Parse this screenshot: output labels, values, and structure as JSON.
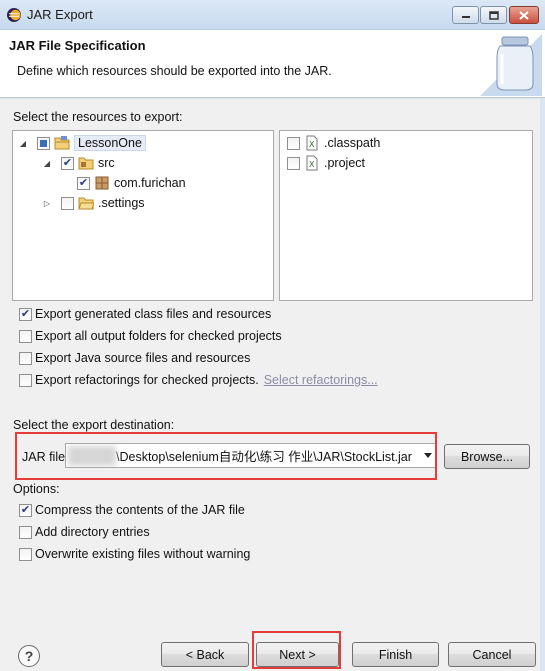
{
  "window": {
    "title": "JAR Export"
  },
  "header": {
    "title": "JAR File Specification",
    "description": "Define which resources should be exported into the JAR."
  },
  "resources": {
    "label": "Select the resources to export:",
    "tree": [
      {
        "label": "LessonOne",
        "icon": "project-folder-icon",
        "state": "partial",
        "expanded": true
      },
      {
        "label": "src",
        "icon": "source-folder-icon",
        "state": "checked",
        "expanded": true
      },
      {
        "label": "com.furichan",
        "icon": "package-icon",
        "state": "checked"
      },
      {
        "label": ".settings",
        "icon": "folder-icon",
        "state": "unchecked",
        "expanded": false
      }
    ],
    "files": [
      {
        "label": ".classpath",
        "icon": "xml-file-icon",
        "state": "unchecked"
      },
      {
        "label": ".project",
        "icon": "xml-file-icon",
        "state": "unchecked"
      }
    ]
  },
  "options_top": {
    "export_class_files": {
      "label": "Export generated class files and resources",
      "checked": true
    },
    "export_output_folders": {
      "label": "Export all output folders for checked projects",
      "checked": false
    },
    "export_java_source": {
      "label": "Export Java source files and resources",
      "checked": false
    },
    "export_refactorings": {
      "label": "Export refactorings for checked projects.",
      "checked": false
    },
    "select_refactorings_link": "Select refactorings..."
  },
  "destination": {
    "label": "Select the export destination:",
    "jar_file_label": "JAR file:",
    "jar_file_value": "\\Desktop\\selenium自动化\\练习 作业\\JAR\\StockList.jar",
    "browse_label": "Browse..."
  },
  "options": {
    "label": "Options:",
    "compress": {
      "label": "Compress the contents of the JAR file",
      "checked": true
    },
    "directory_entries": {
      "label": "Add directory entries",
      "checked": false
    },
    "overwrite": {
      "label": "Overwrite existing files without warning",
      "checked": false
    }
  },
  "footer": {
    "help_label": "?",
    "back_label": "< Back",
    "next_label": "Next >",
    "finish_label": "Finish",
    "cancel_label": "Cancel"
  },
  "colors": {
    "highlight_box": "#e53b3b",
    "link": "#8c8ca8",
    "checkmark": "#233e7a"
  }
}
